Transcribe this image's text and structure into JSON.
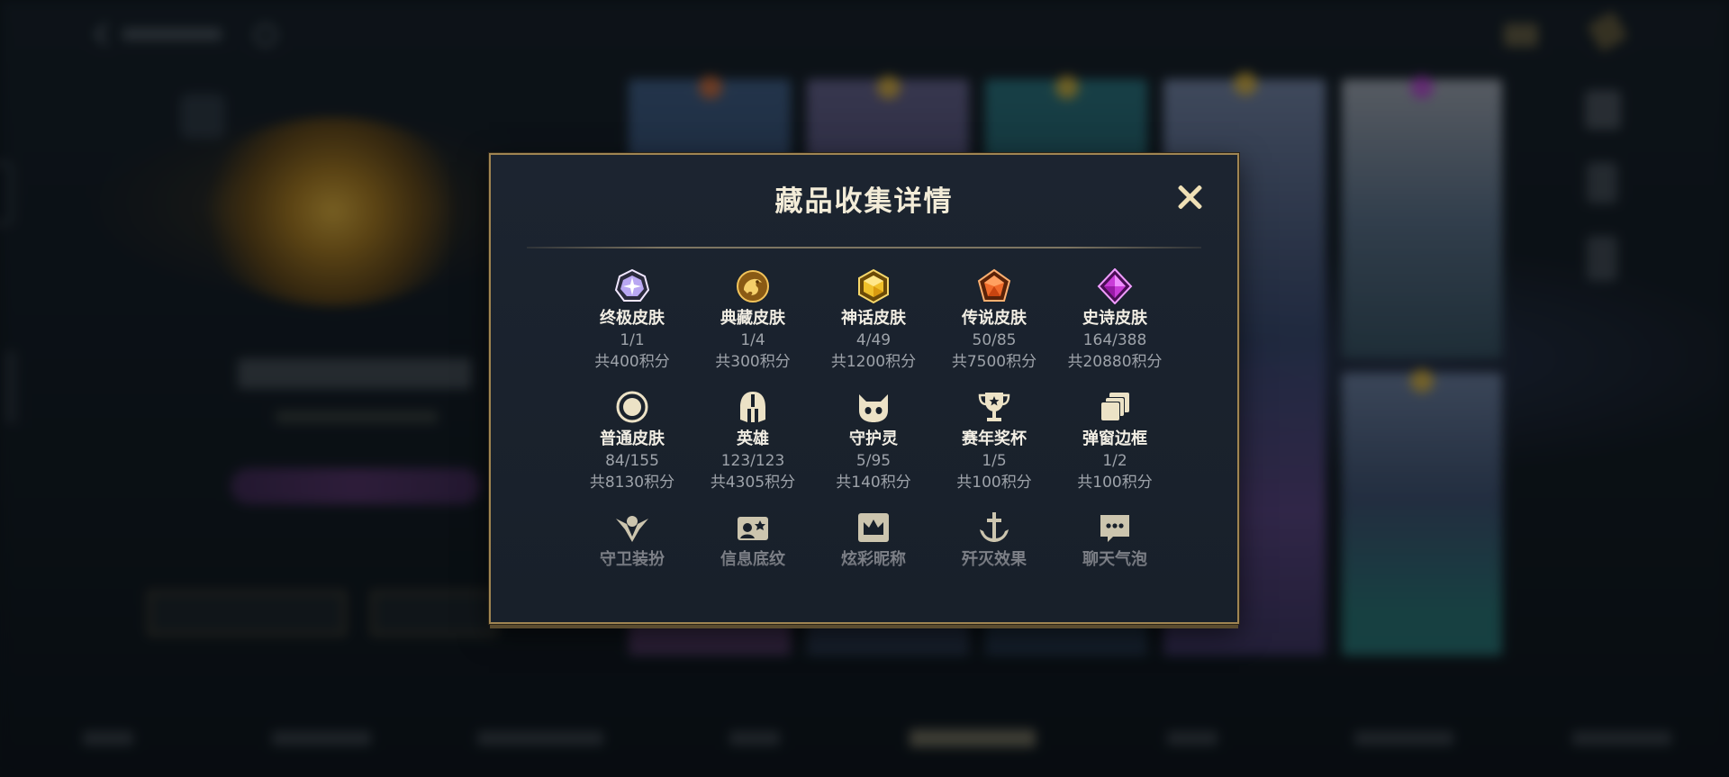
{
  "dialog": {
    "title": "藏品收集详情",
    "close_label": "close"
  },
  "collection": [
    {
      "label": "终极皮肤",
      "count": "1/1",
      "points": "共400积分",
      "icon": "ultimate-skin-gem-icon",
      "color": "#b9a7f2"
    },
    {
      "label": "典藏皮肤",
      "count": "1/4",
      "points": "共300积分",
      "icon": "prestige-dragon-icon",
      "color": "#e1a437"
    },
    {
      "label": "神话皮肤",
      "count": "4/49",
      "points": "共1200积分",
      "icon": "mythic-gem-icon",
      "color": "#f0c02a"
    },
    {
      "label": "传说皮肤",
      "count": "50/85",
      "points": "共7500积分",
      "icon": "legendary-gem-icon",
      "color": "#f06a2a"
    },
    {
      "label": "史诗皮肤",
      "count": "164/388",
      "points": "共20880积分",
      "icon": "epic-gem-icon",
      "color": "#c93bd8"
    },
    {
      "label": "普通皮肤",
      "count": "84/155",
      "points": "共8130积分",
      "icon": "standard-circle-icon",
      "color": "#e9dfc2"
    },
    {
      "label": "英雄",
      "count": "123/123",
      "points": "共4305积分",
      "icon": "helmet-icon",
      "color": "#e9dfc2"
    },
    {
      "label": "守护灵",
      "count": "5/95",
      "points": "共140积分",
      "icon": "cat-guardian-icon",
      "color": "#e9dfc2"
    },
    {
      "label": "赛年奖杯",
      "count": "1/5",
      "points": "共100积分",
      "icon": "trophy-icon",
      "color": "#e9dfc2"
    },
    {
      "label": "弹窗边框",
      "count": "1/2",
      "points": "共100积分",
      "icon": "frame-stack-icon",
      "color": "#e9dfc2"
    }
  ],
  "collection_more": [
    {
      "label": "守卫装扮",
      "icon": "ward-skin-icon"
    },
    {
      "label": "信息底纹",
      "icon": "info-card-icon"
    },
    {
      "label": "炫彩昵称",
      "icon": "crown-nameplate-icon"
    },
    {
      "label": "歼灭效果",
      "icon": "anchor-sword-icon"
    },
    {
      "label": "聊天气泡",
      "icon": "chat-bubble-icon"
    }
  ]
}
